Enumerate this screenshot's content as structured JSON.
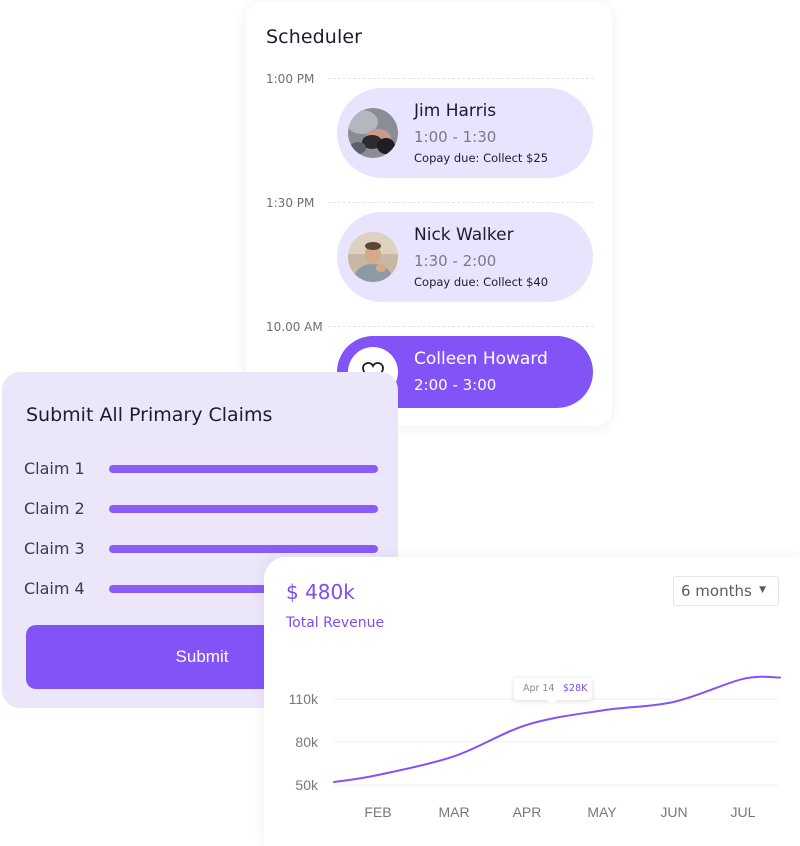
{
  "scheduler": {
    "title": "Scheduler",
    "slots": [
      {
        "time": "1:00 PM",
        "appointment": {
          "name": "Jim Harris",
          "time": "1:00 - 1:30",
          "copay": "Copay due: Collect $25"
        }
      },
      {
        "time": "1:30 PM",
        "appointment": {
          "name": "Nick Walker",
          "time": "1:30 - 2:00",
          "copay": "Copay due: Collect $40"
        }
      },
      {
        "time": "10.00 AM",
        "appointment": {
          "name": "Colleen Howard",
          "time": "2:00 - 3:00"
        }
      }
    ]
  },
  "claims": {
    "title": "Submit All Primary Claims",
    "items": [
      {
        "label": "Claim 1"
      },
      {
        "label": "Claim 2"
      },
      {
        "label": "Claim 3"
      },
      {
        "label": "Claim 4"
      }
    ],
    "submit_label": "Submit"
  },
  "revenue": {
    "value": "$ 480k",
    "label": "Total Revenue",
    "period": "6 months",
    "tooltip": {
      "date": "Apr 14",
      "value": "$28K"
    }
  },
  "colors": {
    "accent": "#8254f7",
    "card_light": "#e9e4fd",
    "claims_bg": "#ece6fb"
  },
  "chart_data": {
    "type": "line",
    "x": [
      "FEB",
      "MAR",
      "APR",
      "MAY",
      "JUN",
      "JUL"
    ],
    "categories": [
      "FEB",
      "MAR",
      "APR",
      "MAY",
      "JUN",
      "JUL"
    ],
    "series": [
      {
        "values": [
          57,
          70,
          92,
          102,
          108,
          124
        ]
      }
    ],
    "y_ticks": [
      "110k",
      "80k",
      "50k"
    ],
    "y_tick_values": [
      110,
      80,
      50
    ],
    "ylim": [
      50,
      125
    ],
    "grid": true
  }
}
